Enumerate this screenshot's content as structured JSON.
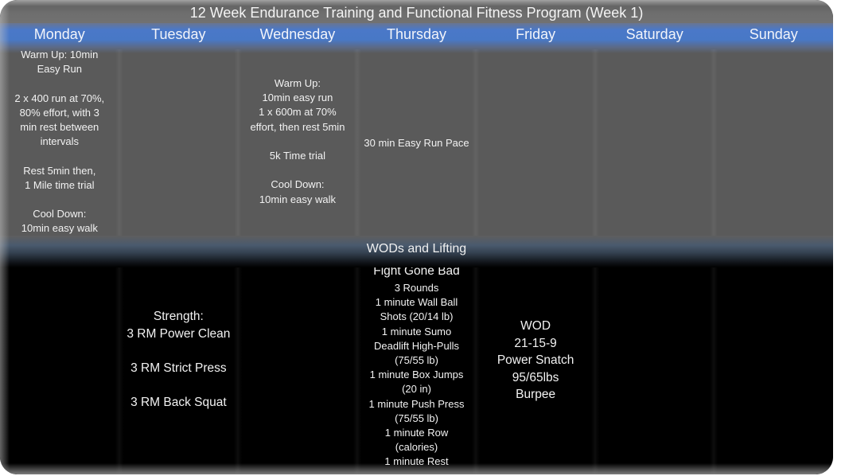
{
  "title": "12 Week Endurance Training and Functional Fitness Program (Week 1)",
  "days": [
    {
      "label": "Monday"
    },
    {
      "label": "Tuesday"
    },
    {
      "label": "Wednesday"
    },
    {
      "label": "Thursday"
    },
    {
      "label": "Friday"
    },
    {
      "label": "Saturday"
    },
    {
      "label": "Sunday"
    }
  ],
  "cardio": {
    "monday": "Warm Up: 10min\nEasy Run\n\n2 x 400 run at 70%,\n80% effort,  with 3\nmin rest between\nintervals\n\nRest 5min then,\n1 Mile time trial\n\nCool Down:\n10min easy walk",
    "tuesday": "",
    "wednesday": "Warm Up:\n10min easy run\n1 x 600m at 70%\neffort, then rest 5min\n\n5k Time trial\n\nCool Down:\n10min easy walk",
    "thursday": "30 min Easy Run Pace",
    "friday": "",
    "saturday": "",
    "sunday": ""
  },
  "wod_section_title": "WODs and Lifting",
  "wod": {
    "monday": "",
    "tuesday": "Strength:\n3 RM Power Clean\n\n3 RM Strict Press\n\n3 RM Back Squat",
    "wednesday": "",
    "thursday_title": "Fight Gone Bad",
    "thursday": "3 Rounds\n1 minute Wall Ball\nShots (20/14 lb)\n1 minute Sumo\nDeadlift High-Pulls\n(75/55 lb)\n1 minute Box Jumps\n(20 in)\n1 minute Push Press\n(75/55 lb)\n1 minute Row\n(calories)\n1 minute Rest",
    "friday": "WOD\n21-15-9\nPower Snatch\n95/65lbs\nBurpee",
    "saturday": "",
    "sunday": ""
  },
  "colors": {
    "header_blue": "#4878c6",
    "cardio_bg": "#5a5a5a",
    "wod_bg": "#000000",
    "title_bg": "#6e6e6e"
  }
}
